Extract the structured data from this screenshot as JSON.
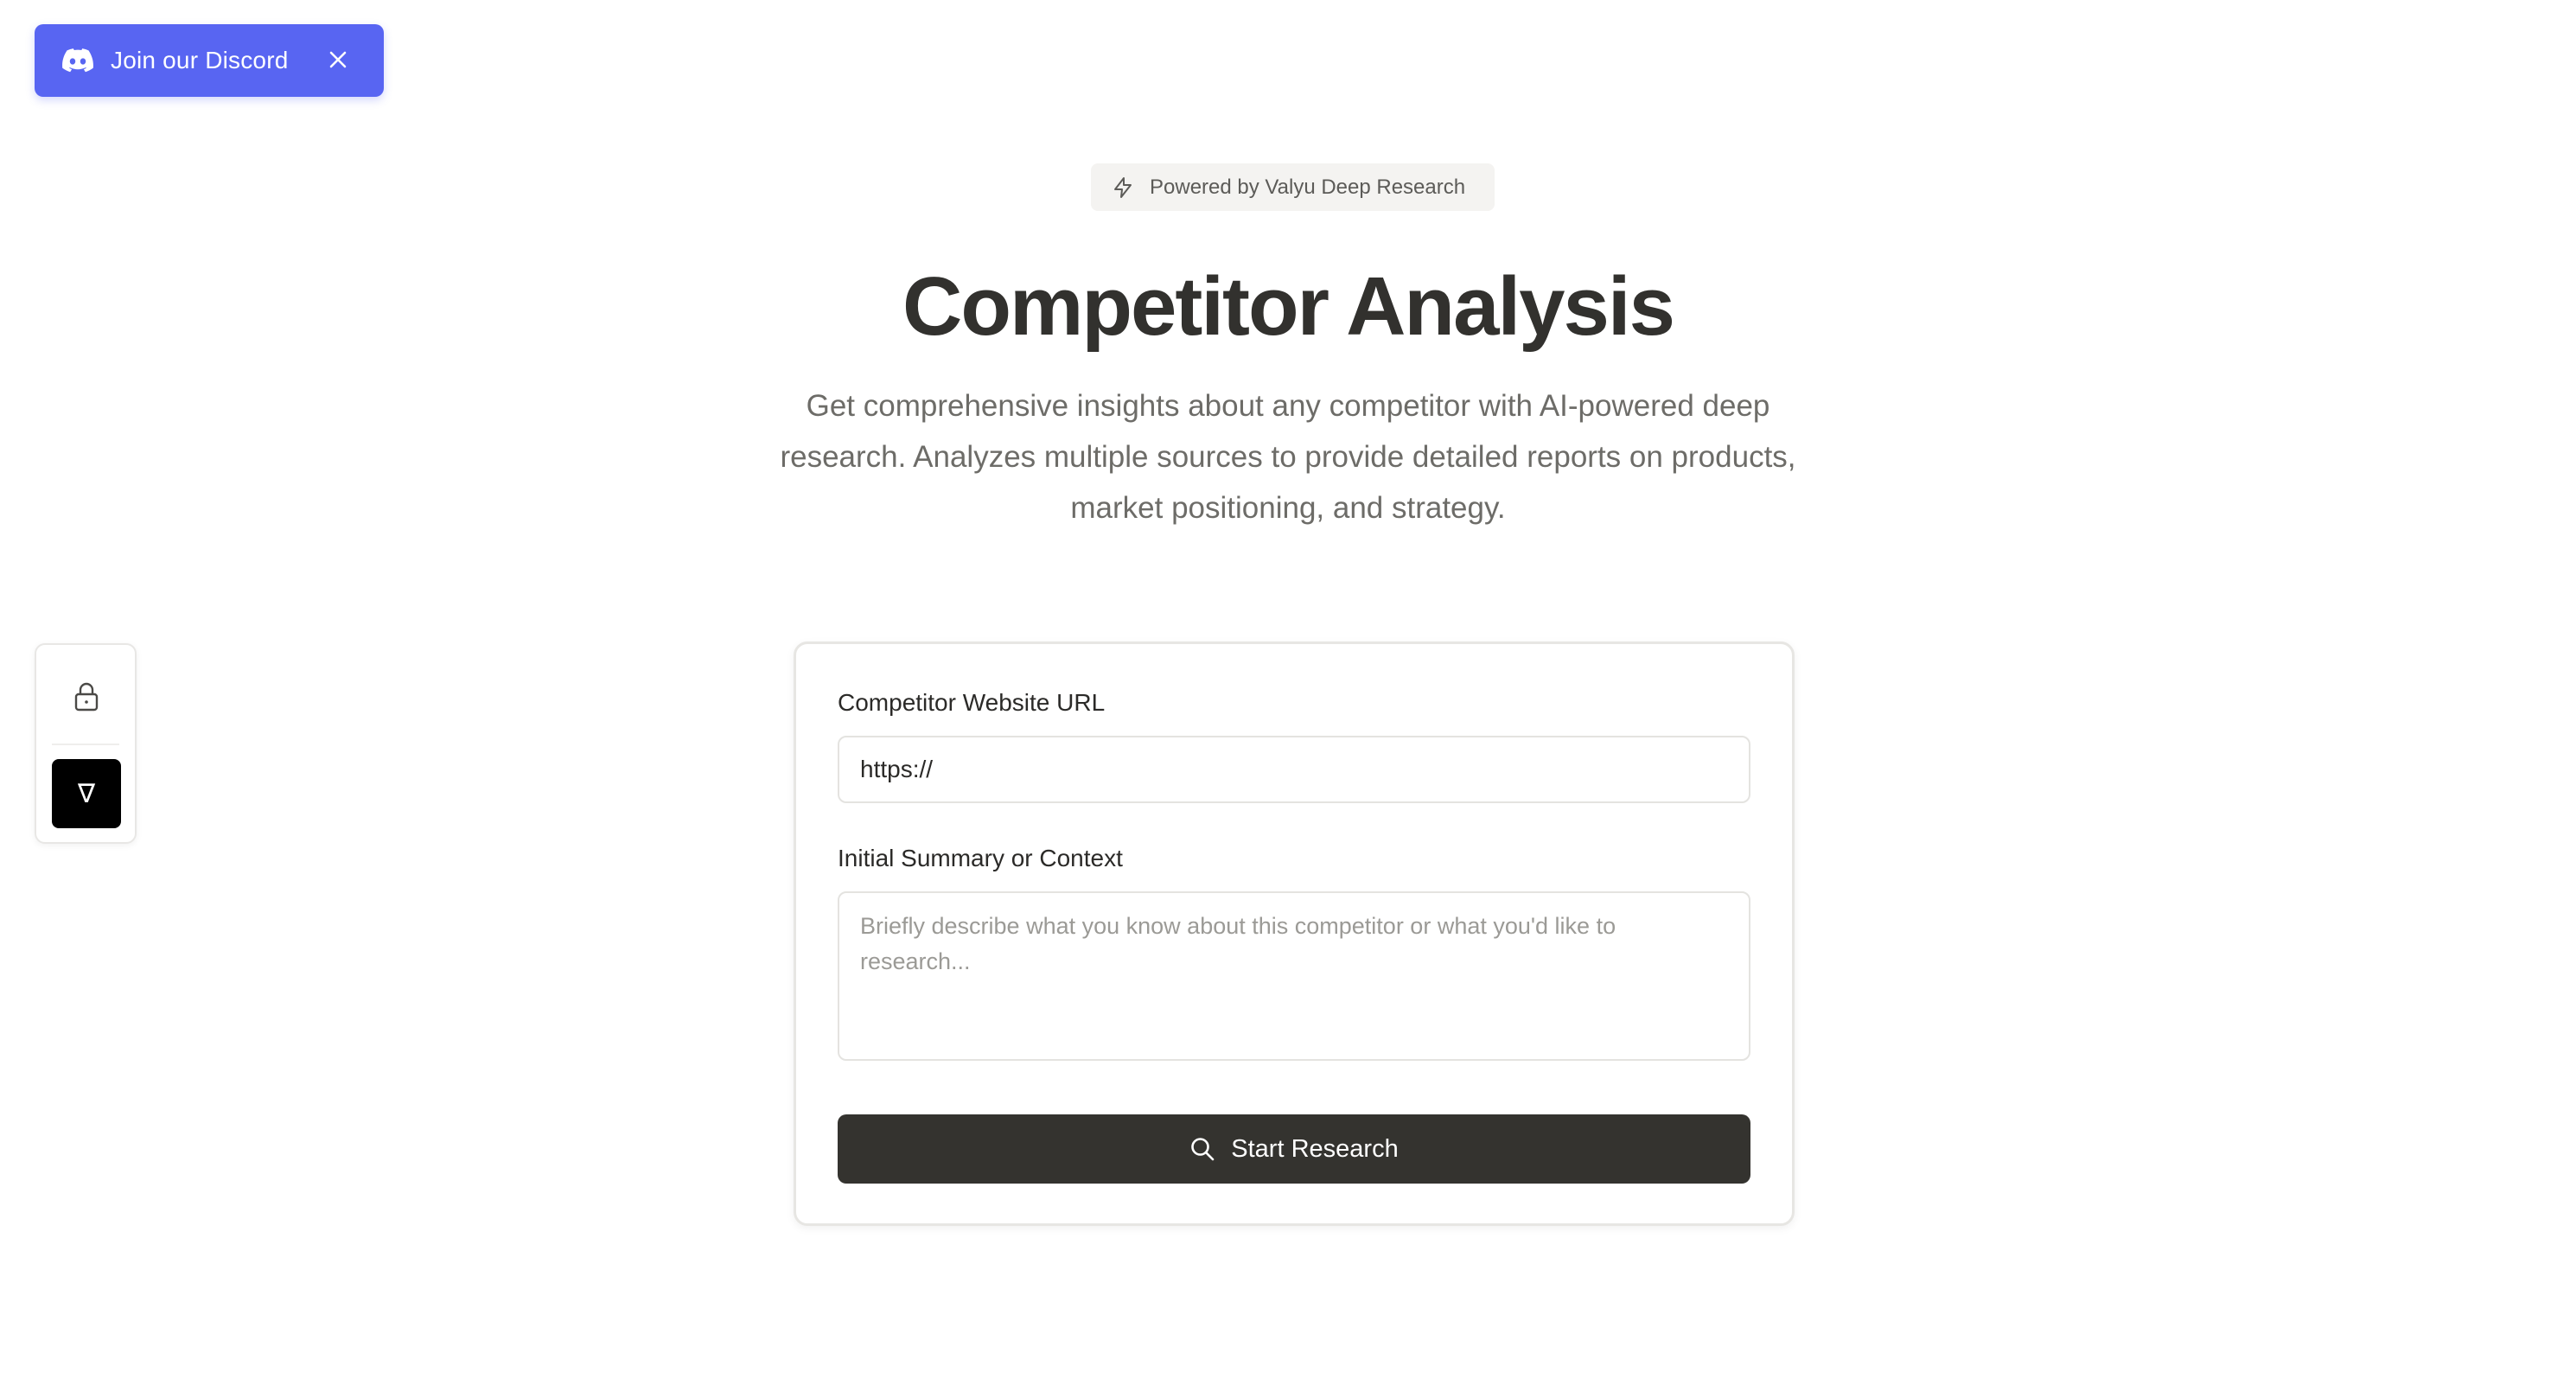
{
  "discord_banner": {
    "label": "Join our Discord",
    "icon": "discord-icon",
    "close_icon": "close-icon",
    "color": "#5865f2"
  },
  "hero": {
    "badge_icon": "bolt-icon",
    "badge_text": "Powered by Valyu Deep Research",
    "title": "Competitor Analysis",
    "subtitle": "Get comprehensive insights about any competitor with AI-powered deep research. Analyzes multiple sources to provide detailed reports on products, market positioning, and strategy."
  },
  "side_panel": {
    "lock_icon": "lock-icon",
    "toggle_glyph": "∇",
    "toggle_icon": "nabla-icon"
  },
  "form": {
    "url_label": "Competitor Website URL",
    "url_value": "https://",
    "context_label": "Initial Summary or Context",
    "context_placeholder": "Briefly describe what you know about this competitor or what you'd like to research...",
    "context_value": "",
    "submit_label": "Start Research",
    "submit_icon": "search-icon",
    "submit_color": "#34332f"
  }
}
